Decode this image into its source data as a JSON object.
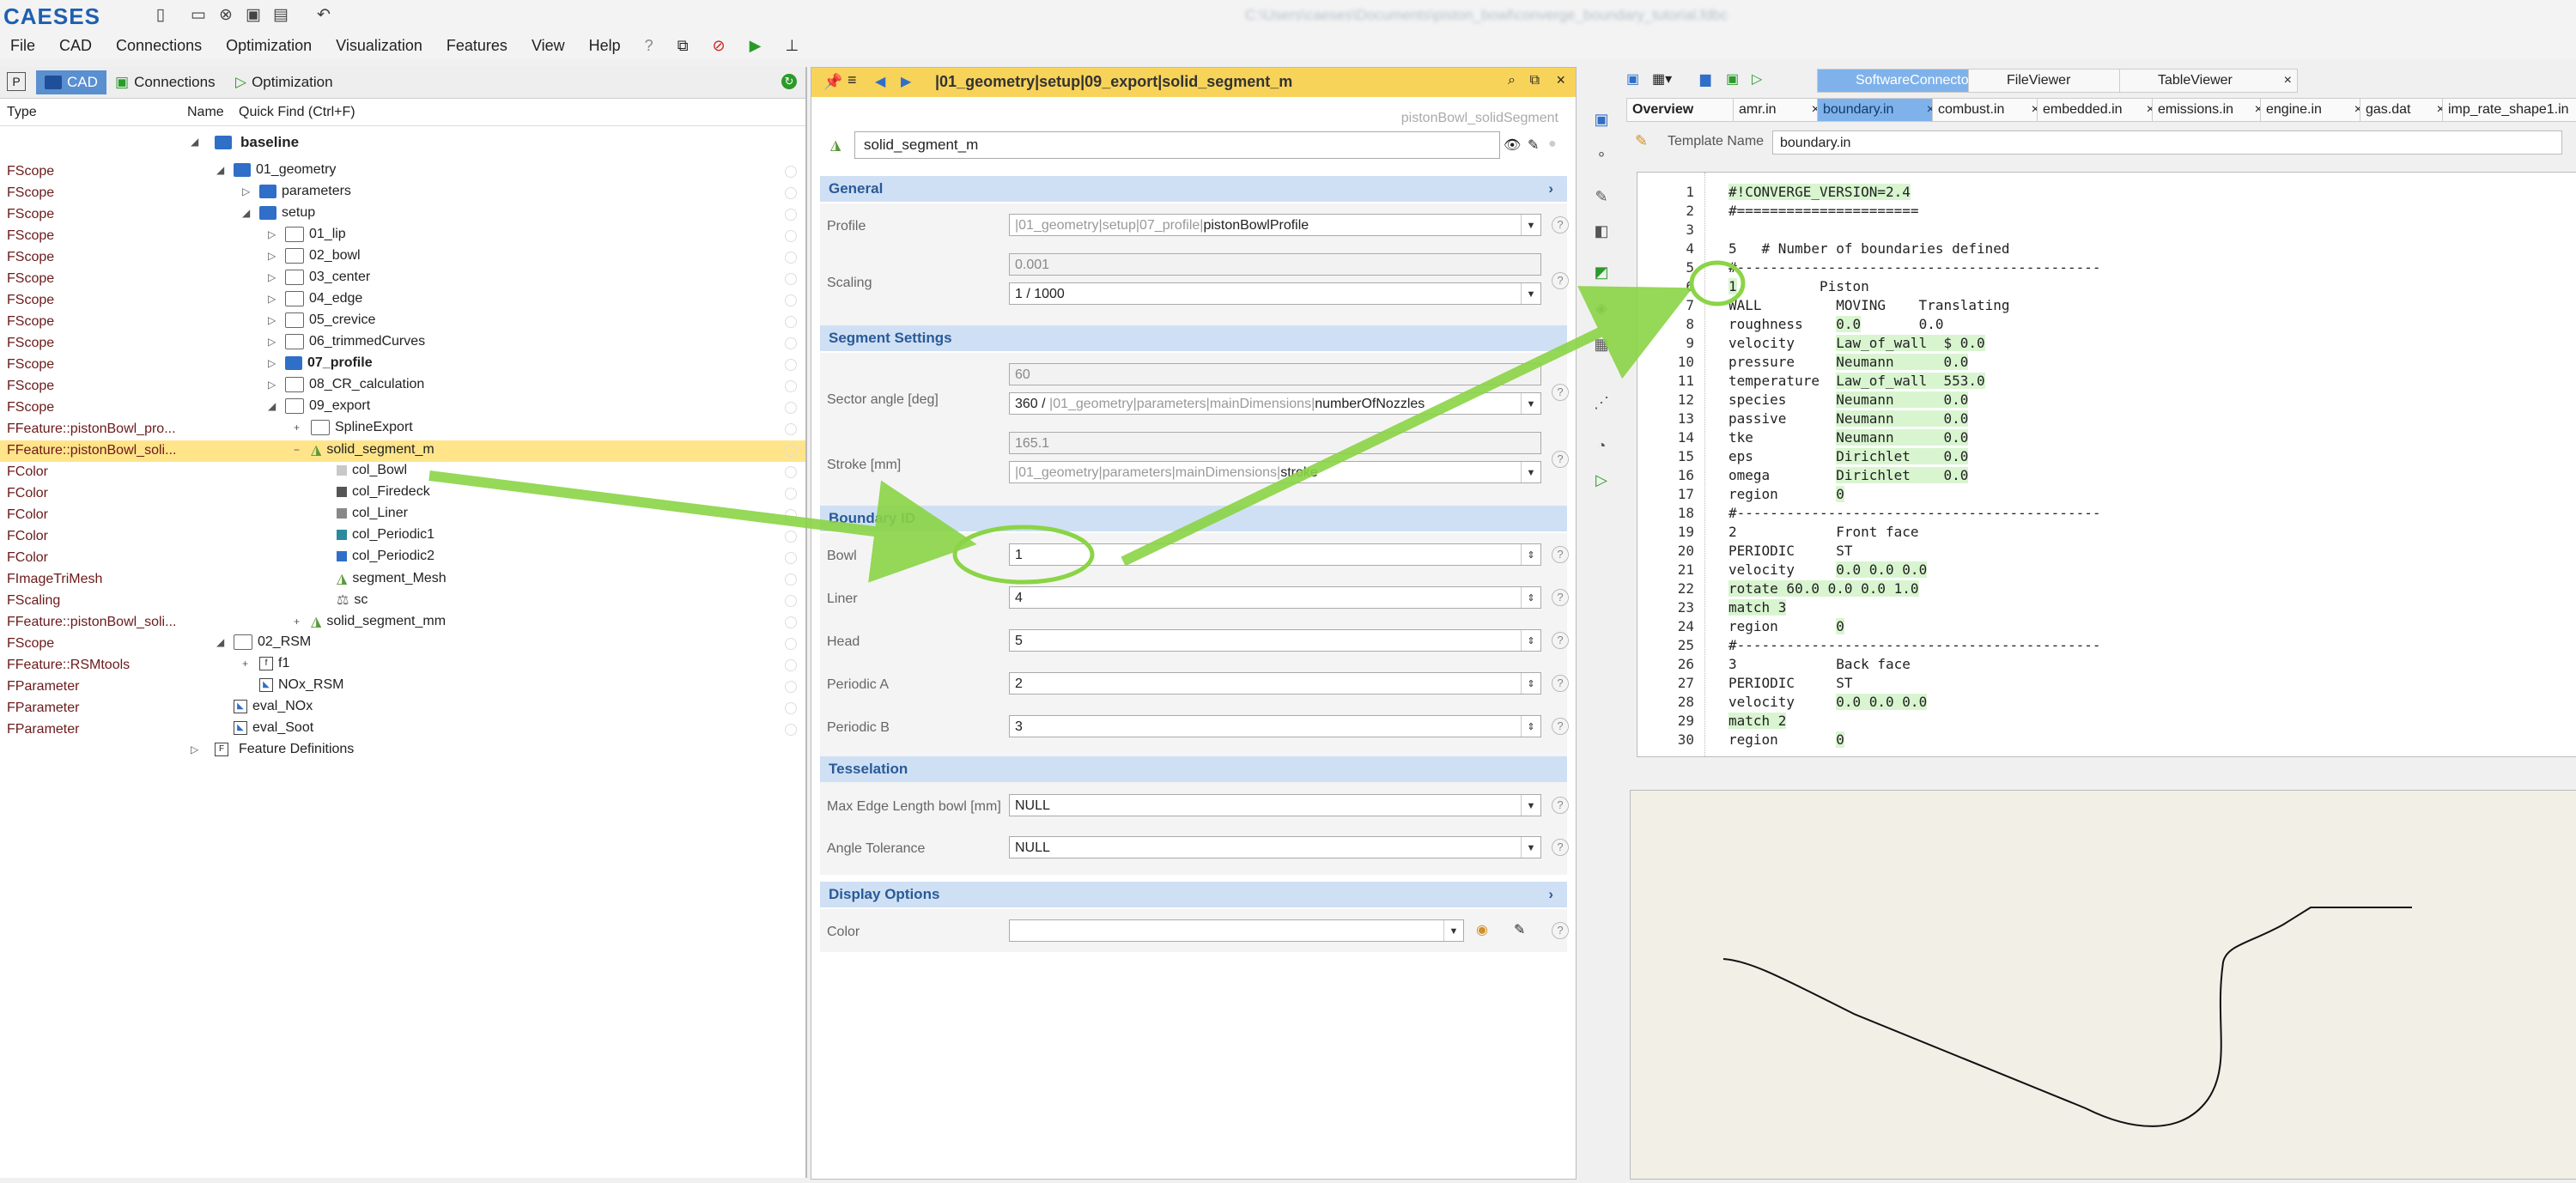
{
  "app": {
    "logo": "CAESES",
    "window_title": "C:\\Users\\caeses\\Documents\\piston_bowl\\converge_boundary_tutorial.fdbc"
  },
  "menu": [
    "File",
    "CAD",
    "Connections",
    "Optimization",
    "Visualization",
    "Features",
    "View",
    "Help"
  ],
  "left_panel": {
    "tabs": {
      "cad": "CAD",
      "connections": "Connections",
      "optimization": "Optimization"
    },
    "columns": {
      "type": "Type",
      "name": "Name",
      "quick_find": "Quick Find (Ctrl+F)"
    },
    "baseline": "baseline",
    "rows": [
      {
        "type": "FScope",
        "name": "01_geometry",
        "indent": 0,
        "icon": "folder-blue",
        "arrow": "open"
      },
      {
        "type": "FScope",
        "name": "parameters",
        "indent": 1,
        "icon": "folder-blue",
        "arrow": "closed"
      },
      {
        "type": "FScope",
        "name": "setup",
        "indent": 1,
        "icon": "folder-blue",
        "arrow": "open"
      },
      {
        "type": "FScope",
        "name": "01_lip",
        "indent": 2,
        "icon": "folder-white",
        "arrow": "closed"
      },
      {
        "type": "FScope",
        "name": "02_bowl",
        "indent": 2,
        "icon": "folder-white",
        "arrow": "closed"
      },
      {
        "type": "FScope",
        "name": "03_center",
        "indent": 2,
        "icon": "folder-white",
        "arrow": "closed"
      },
      {
        "type": "FScope",
        "name": "04_edge",
        "indent": 2,
        "icon": "folder-white",
        "arrow": "closed"
      },
      {
        "type": "FScope",
        "name": "05_crevice",
        "indent": 2,
        "icon": "folder-white",
        "arrow": "closed"
      },
      {
        "type": "FScope",
        "name": "06_trimmedCurves",
        "indent": 2,
        "icon": "folder-white",
        "arrow": "closed"
      },
      {
        "type": "FScope",
        "name": "07_profile",
        "indent": 2,
        "icon": "folder-blue",
        "arrow": "closed"
      },
      {
        "type": "FScope",
        "name": "08_CR_calculation",
        "indent": 2,
        "icon": "folder-white",
        "arrow": "closed"
      },
      {
        "type": "FScope",
        "name": "09_export",
        "indent": 2,
        "icon": "folder-white",
        "arrow": "open"
      },
      {
        "type": "FFeature::pistonBowl_pro...",
        "name": "SplineExport",
        "indent": 3,
        "icon": "folder-white",
        "arrow": "plus"
      },
      {
        "type": "FFeature::pistonBowl_soli...",
        "name": "solid_segment_m",
        "indent": 3,
        "icon": "feature",
        "arrow": "minus",
        "selected": true
      },
      {
        "type": "FColor",
        "name": "col_Bowl",
        "indent": 4,
        "icon": "sq-lightgray"
      },
      {
        "type": "FColor",
        "name": "col_Firedeck",
        "indent": 4,
        "icon": "sq-darkgray"
      },
      {
        "type": "FColor",
        "name": "col_Liner",
        "indent": 4,
        "icon": "sq-gray"
      },
      {
        "type": "FColor",
        "name": "col_Periodic1",
        "indent": 4,
        "icon": "sq-teal"
      },
      {
        "type": "FColor",
        "name": "col_Periodic2",
        "indent": 4,
        "icon": "sq-blue"
      },
      {
        "type": "FImageTriMesh",
        "name": "segment_Mesh",
        "indent": 4,
        "icon": "mesh"
      },
      {
        "type": "FScaling",
        "name": "sc",
        "indent": 4,
        "icon": "scale"
      },
      {
        "type": "FFeature::pistonBowl_soli...",
        "name": "solid_segment_mm",
        "indent": 3,
        "icon": "feature",
        "arrow": "plus"
      },
      {
        "type": "FScope",
        "name": "02_RSM",
        "indent": 0,
        "icon": "folder-white",
        "arrow": "open"
      },
      {
        "type": "FFeature::RSMtools",
        "name": "f1",
        "indent": 1,
        "icon": "fbox",
        "arrow": "plus"
      },
      {
        "type": "FParameter",
        "name": "NOx_RSM",
        "indent": 1,
        "icon": "param"
      },
      {
        "type": "FParameter",
        "name": "eval_NOx",
        "indent": 0,
        "icon": "param"
      },
      {
        "type": "FParameter",
        "name": "eval_Soot",
        "indent": 0,
        "icon": "param"
      }
    ],
    "feature_definitions": "Feature Definitions"
  },
  "mid_panel": {
    "path": "|01_geometry|setup|09_export|solid_segment_m",
    "subtitle": "pistonBowl_solidSegment",
    "name": "solid_segment_m",
    "sections": {
      "general": "General",
      "segment": "Segment Settings",
      "boundary": "Boundary ID",
      "tesselation": "Tesselation",
      "display": "Display Options"
    },
    "profile": {
      "label": "Profile",
      "prefix": "|01_geometry|setup|07_profile|",
      "value": "pistonBowlProfile"
    },
    "scaling": {
      "label": "Scaling",
      "result": "0.001",
      "expr": "1 / 1000"
    },
    "sector": {
      "label": "Sector angle [deg]",
      "result": "60",
      "expr_a": "360 / ",
      "expr_b": "|01_geometry|parameters|mainDimensions|",
      "expr_c": "numberOfNozzles"
    },
    "stroke": {
      "label": "Stroke [mm]",
      "result": "165.1",
      "expr_b": "|01_geometry|parameters|mainDimensions|",
      "expr_c": "stroke"
    },
    "boundary_ids": [
      {
        "label": "Bowl",
        "value": "1"
      },
      {
        "label": "Liner",
        "value": "4"
      },
      {
        "label": "Head",
        "value": "5"
      },
      {
        "label": "Periodic A",
        "value": "2"
      },
      {
        "label": "Periodic B",
        "value": "3"
      }
    ],
    "max_edge": {
      "label": "Max Edge Length bowl [mm]",
      "value": "NULL"
    },
    "angle_tol": {
      "label": "Angle Tolerance",
      "value": "NULL"
    },
    "color": {
      "label": "Color",
      "value": ""
    }
  },
  "right_panel": {
    "view_tabs": [
      "SoftwareConnector",
      "FileViewer",
      "TableViewer"
    ],
    "file_tabs": [
      "Overview",
      "amr.in",
      "boundary.in",
      "combust.in",
      "embedded.in",
      "emissions.in",
      "engine.in",
      "gas.dat",
      "imp_rate_shape1.in"
    ],
    "active_file": "boundary.in",
    "template_label": "Template Name",
    "template_value": "boundary.in",
    "code_lines": [
      {
        "n": "1",
        "segs": [
          [
            "#!CONVERGE_VERSION=2.4",
            true
          ]
        ]
      },
      {
        "n": "2",
        "segs": [
          [
            "#======================",
            false
          ]
        ]
      },
      {
        "n": "3",
        "segs": [
          [
            "",
            false
          ]
        ]
      },
      {
        "n": "4",
        "segs": [
          [
            "5   # Number of boundaries defined",
            false
          ]
        ]
      },
      {
        "n": "5",
        "segs": [
          [
            "#--------------------------------------------",
            false
          ]
        ]
      },
      {
        "n": "6",
        "segs": [
          [
            "1",
            true
          ],
          [
            "          Piston",
            false
          ]
        ]
      },
      {
        "n": "7",
        "segs": [
          [
            "WALL         MOVING    Translating",
            false
          ]
        ]
      },
      {
        "n": "8",
        "segs": [
          [
            "roughness    ",
            false
          ],
          [
            "0.0",
            true
          ],
          [
            "       0.0",
            false
          ]
        ]
      },
      {
        "n": "9",
        "segs": [
          [
            "velocity     ",
            false
          ],
          [
            "Law_of_wall  $ 0.0",
            true
          ]
        ]
      },
      {
        "n": "10",
        "segs": [
          [
            "pressure     ",
            false
          ],
          [
            "Neumann      0.0",
            true
          ]
        ]
      },
      {
        "n": "11",
        "segs": [
          [
            "temperature  ",
            false
          ],
          [
            "Law_of_wall  553.0",
            true
          ]
        ]
      },
      {
        "n": "12",
        "segs": [
          [
            "species      ",
            false
          ],
          [
            "Neumann      0.0",
            true
          ]
        ]
      },
      {
        "n": "13",
        "segs": [
          [
            "passive      ",
            false
          ],
          [
            "Neumann      0.0",
            true
          ]
        ]
      },
      {
        "n": "14",
        "segs": [
          [
            "tke          ",
            false
          ],
          [
            "Neumann      0.0",
            true
          ]
        ]
      },
      {
        "n": "15",
        "segs": [
          [
            "eps          ",
            false
          ],
          [
            "Dirichlet    0.0",
            true
          ]
        ]
      },
      {
        "n": "16",
        "segs": [
          [
            "omega        ",
            false
          ],
          [
            "Dirichlet    0.0",
            true
          ]
        ]
      },
      {
        "n": "17",
        "segs": [
          [
            "region       ",
            false
          ],
          [
            "0",
            true
          ]
        ]
      },
      {
        "n": "18",
        "segs": [
          [
            "#--------------------------------------------",
            false
          ]
        ]
      },
      {
        "n": "19",
        "segs": [
          [
            "2            Front face",
            false
          ]
        ]
      },
      {
        "n": "20",
        "segs": [
          [
            "PERIODIC     ST",
            false
          ]
        ]
      },
      {
        "n": "21",
        "segs": [
          [
            "velocity     ",
            false
          ],
          [
            "0.0 0.0 0.0",
            true
          ]
        ]
      },
      {
        "n": "22",
        "segs": [
          [
            "rotate 60.0 0.0 0.0 1.0",
            true
          ]
        ]
      },
      {
        "n": "23",
        "segs": [
          [
            "match 3",
            true
          ]
        ]
      },
      {
        "n": "24",
        "segs": [
          [
            "region       ",
            false
          ],
          [
            "0",
            true
          ]
        ]
      },
      {
        "n": "25",
        "segs": [
          [
            "#--------------------------------------------",
            false
          ]
        ]
      },
      {
        "n": "26",
        "segs": [
          [
            "3            Back face",
            false
          ]
        ]
      },
      {
        "n": "27",
        "segs": [
          [
            "PERIODIC     ST",
            false
          ]
        ]
      },
      {
        "n": "28",
        "segs": [
          [
            "velocity     ",
            false
          ],
          [
            "0.0 0.0 0.0",
            true
          ]
        ]
      },
      {
        "n": "29",
        "segs": [
          [
            "match 2",
            true
          ]
        ]
      },
      {
        "n": "30",
        "segs": [
          [
            "region       ",
            false
          ],
          [
            "0",
            true
          ]
        ]
      }
    ]
  },
  "colors": {
    "accent": "#2f6fc7",
    "selection": "#ffe48a",
    "header_yellow": "#f7d35a",
    "section_blue": "#cfe0f5",
    "arrow_green": "#8bd446",
    "code_highlight": "#d8f5d0"
  }
}
